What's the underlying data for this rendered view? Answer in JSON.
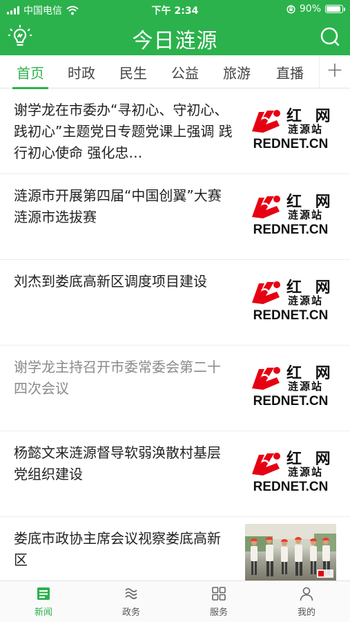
{
  "status_bar": {
    "carrier": "中国电信",
    "time": "下午 2:34",
    "battery": "90%",
    "battery_level": 0.9
  },
  "header": {
    "title": "今日涟源",
    "left_icon": "lightbulb-icon",
    "right_icon": "search-icon"
  },
  "tabs": [
    {
      "label": "首页",
      "active": true
    },
    {
      "label": "时政",
      "active": false
    },
    {
      "label": "民生",
      "active": false
    },
    {
      "label": "公益",
      "active": false
    },
    {
      "label": "旅游",
      "active": false
    },
    {
      "label": "直播",
      "active": false
    }
  ],
  "add_tab": "+",
  "news": [
    {
      "title": "谢学龙在市委办“寻初心、守初心、践初心”主题党日专题党课上强调 践行初心使命 强化忠…",
      "thumb": "rednet-logo",
      "read": false
    },
    {
      "title": "涟源市开展第四届“中国创翼”大赛涟源市选拔赛",
      "thumb": "rednet-logo",
      "read": false
    },
    {
      "title": "刘杰到娄底高新区调度项目建设",
      "thumb": "rednet-logo",
      "read": false
    },
    {
      "title": "谢学龙主持召开市委常委会第二十四次会议",
      "thumb": "rednet-logo",
      "read": true
    },
    {
      "title": "杨懿文来涟源督导软弱涣散村基层党组织建设",
      "thumb": "rednet-logo",
      "read": false
    },
    {
      "title": "娄底市政协主席会议视察娄底高新区",
      "thumb": "photo",
      "read": false
    }
  ],
  "logo": {
    "brand": "红 网",
    "station": "涟源站",
    "domain": "REDNET.CN",
    "brand_color": "#e60012"
  },
  "bottom_nav": [
    {
      "label": "新闻",
      "icon": "news-icon",
      "active": true
    },
    {
      "label": "政务",
      "icon": "government-icon",
      "active": false
    },
    {
      "label": "服务",
      "icon": "grid-icon",
      "active": false
    },
    {
      "label": "我的",
      "icon": "user-icon",
      "active": false
    }
  ],
  "colors": {
    "accent": "#2bb24c",
    "text": "#222222",
    "read_text": "#8a8a8a"
  }
}
